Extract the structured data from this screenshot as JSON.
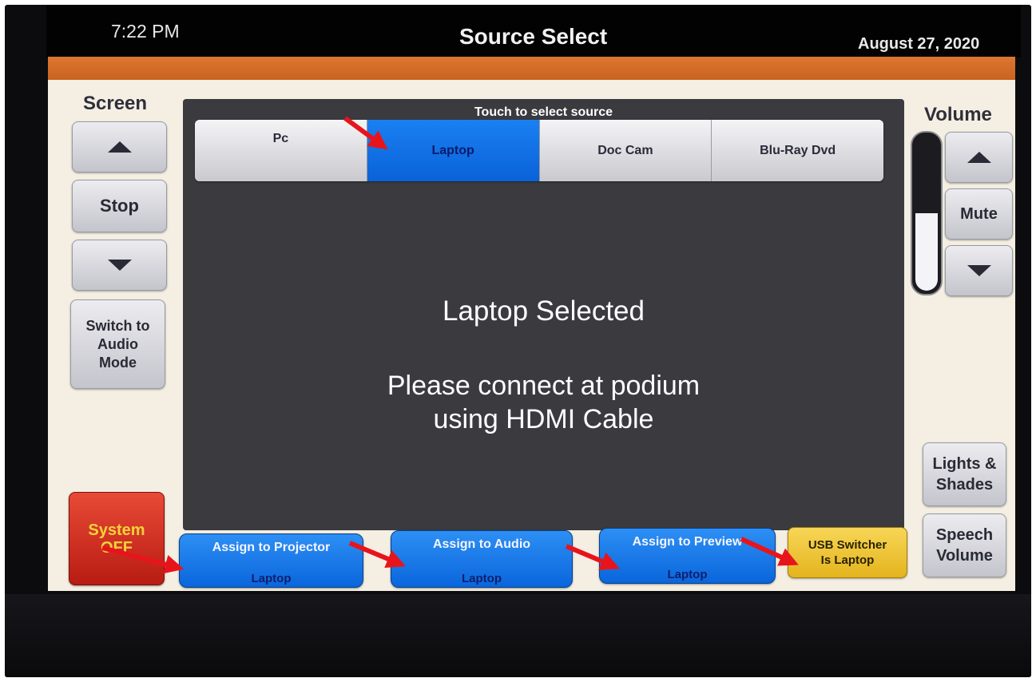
{
  "header": {
    "time": "7:22 PM",
    "title": "Source Select",
    "date": "August 27, 2020"
  },
  "screen": {
    "label": "Screen",
    "stop_label": "Stop",
    "switch_audio_lines": [
      "Switch to",
      "Audio",
      "Mode"
    ]
  },
  "system_off": {
    "line1": "System",
    "line2": "OFF"
  },
  "source": {
    "prompt": "Touch to select source",
    "tabs": [
      "Pc",
      "Laptop",
      "Doc Cam",
      "Blu-Ray Dvd"
    ],
    "selected": "Laptop"
  },
  "message": {
    "status": "Laptop Selected",
    "line1": "Please connect at podium",
    "line2": "using HDMI Cable"
  },
  "volume": {
    "label": "Volume",
    "mute_label": "Mute",
    "level_fraction": 0.5
  },
  "right_buttons": {
    "lights_line1": "Lights &",
    "lights_line2": "Shades",
    "speech_line1": "Speech",
    "speech_line2": "Volume"
  },
  "assign": {
    "projector_title": "Assign to Projector",
    "projector_value": "Laptop",
    "audio_title": "Assign to Audio",
    "audio_value": "Laptop",
    "preview_title": "Assign to Preview",
    "preview_value": "Laptop"
  },
  "usb": {
    "line1": "USB Switcher",
    "line2": "Is Laptop"
  },
  "colors": {
    "accent_orange": "#d86a28",
    "selected_blue": "#0a62d8",
    "usb_yellow": "#f1c83a",
    "system_off_red": "#d23020",
    "annotation_arrow_red": "#e8141c"
  }
}
